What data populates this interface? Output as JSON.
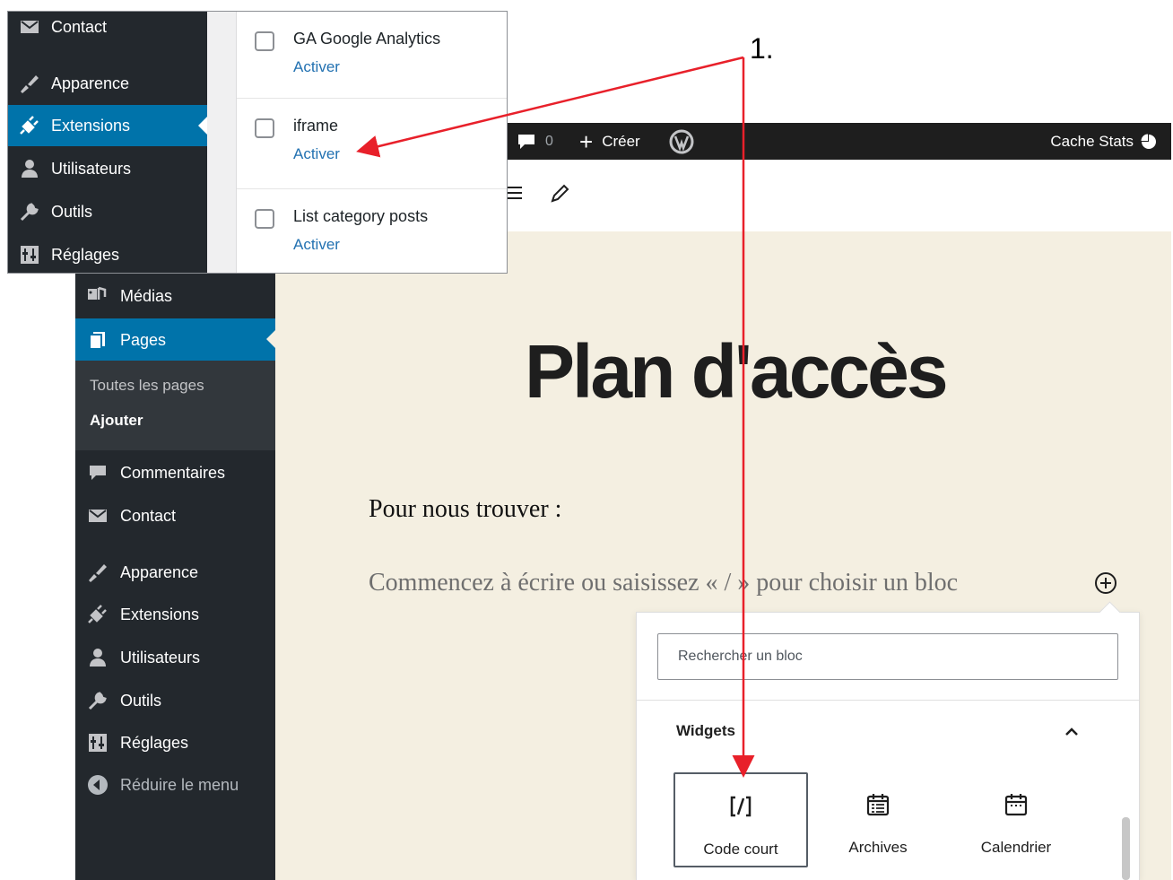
{
  "zoom": {
    "sidebar": [
      {
        "label": "Contact",
        "icon": "envelope-icon"
      },
      {
        "label": "Apparence",
        "icon": "paintbrush-icon"
      },
      {
        "label": "Extensions",
        "icon": "plugin-icon",
        "active": true
      },
      {
        "label": "Utilisateurs",
        "icon": "users-icon"
      },
      {
        "label": "Outils",
        "icon": "wrench-icon"
      },
      {
        "label": "Réglages",
        "icon": "settings-icon"
      }
    ],
    "plugins": [
      {
        "name": "GA Google Analytics",
        "action": "Activer"
      },
      {
        "name": "iframe",
        "action": "Activer"
      },
      {
        "name": "List category posts",
        "action": "Activer"
      }
    ]
  },
  "adminbar": {
    "comments_count": "0",
    "create_label": "Créer",
    "cache_label": "Cache Stats"
  },
  "sidebar": {
    "items": [
      {
        "label": "Médias",
        "icon": "media-icon"
      },
      {
        "label": "Pages",
        "icon": "pages-icon",
        "active": true
      },
      {
        "label": "Commentaires",
        "icon": "comment-icon"
      },
      {
        "label": "Contact",
        "icon": "envelope-icon"
      },
      {
        "label": "Apparence",
        "icon": "paintbrush-icon"
      },
      {
        "label": "Extensions",
        "icon": "plugin-icon"
      },
      {
        "label": "Utilisateurs",
        "icon": "users-icon"
      },
      {
        "label": "Outils",
        "icon": "wrench-icon"
      },
      {
        "label": "Réglages",
        "icon": "settings-icon"
      }
    ],
    "submenu": [
      "Toutes les pages",
      "Ajouter"
    ],
    "collapse_label": "Réduire le menu"
  },
  "editor": {
    "title": "Plan d'accès",
    "paragraph": "Pour nous trouver :",
    "placeholder": "Commencez à écrire ou saisissez « / » pour choisir un bloc"
  },
  "inserter": {
    "search_placeholder": "Rechercher un bloc",
    "panel_title": "Widgets",
    "blocks": [
      {
        "label": "Code court",
        "icon": "shortcode-icon",
        "selected": true
      },
      {
        "label": "Archives",
        "icon": "archive-icon"
      },
      {
        "label": "Calendrier",
        "icon": "calendar-icon"
      }
    ]
  },
  "annotation": {
    "label": "1.",
    "color": "#e8202a"
  },
  "colors": {
    "admin_dark": "#23282d",
    "admin_blue": "#0073aa",
    "link_blue": "#2271b1",
    "canvas": "#f4efe1"
  }
}
